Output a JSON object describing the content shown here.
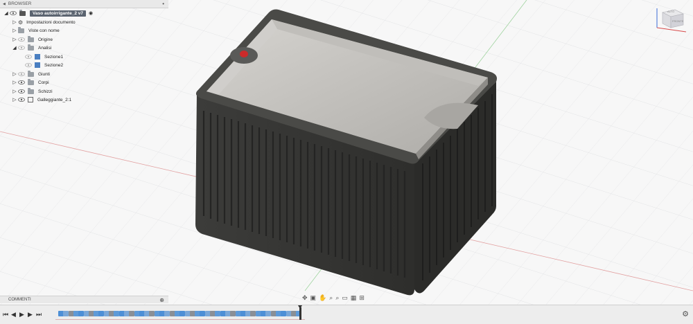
{
  "browser": {
    "title": "BROWSER",
    "items": [
      {
        "label": "Vaso autoirrigante_2 v7",
        "type": "root"
      },
      {
        "label": "Impostazioni documento",
        "type": "settings"
      },
      {
        "label": "Viste con nome",
        "type": "folder"
      },
      {
        "label": "Origine",
        "type": "folder"
      },
      {
        "label": "Analisi",
        "type": "folder"
      },
      {
        "label": "Sezione1",
        "type": "section"
      },
      {
        "label": "Sezione2",
        "type": "section"
      },
      {
        "label": "Giunti",
        "type": "folder"
      },
      {
        "label": "Corpi",
        "type": "folder"
      },
      {
        "label": "Schizzi",
        "type": "folder"
      },
      {
        "label": "Galleggiante_2:1",
        "type": "component"
      }
    ]
  },
  "comments": {
    "title": "COMMENTI"
  },
  "navcube": {
    "top": "ALTO",
    "front": "FRONTE"
  },
  "colors": {
    "body": "#3a3a38",
    "interior": "#c8c6c2",
    "accent_red": "#cc2a2a",
    "grid": "#d8dadc"
  },
  "timeline": {
    "feature_count": 48
  }
}
